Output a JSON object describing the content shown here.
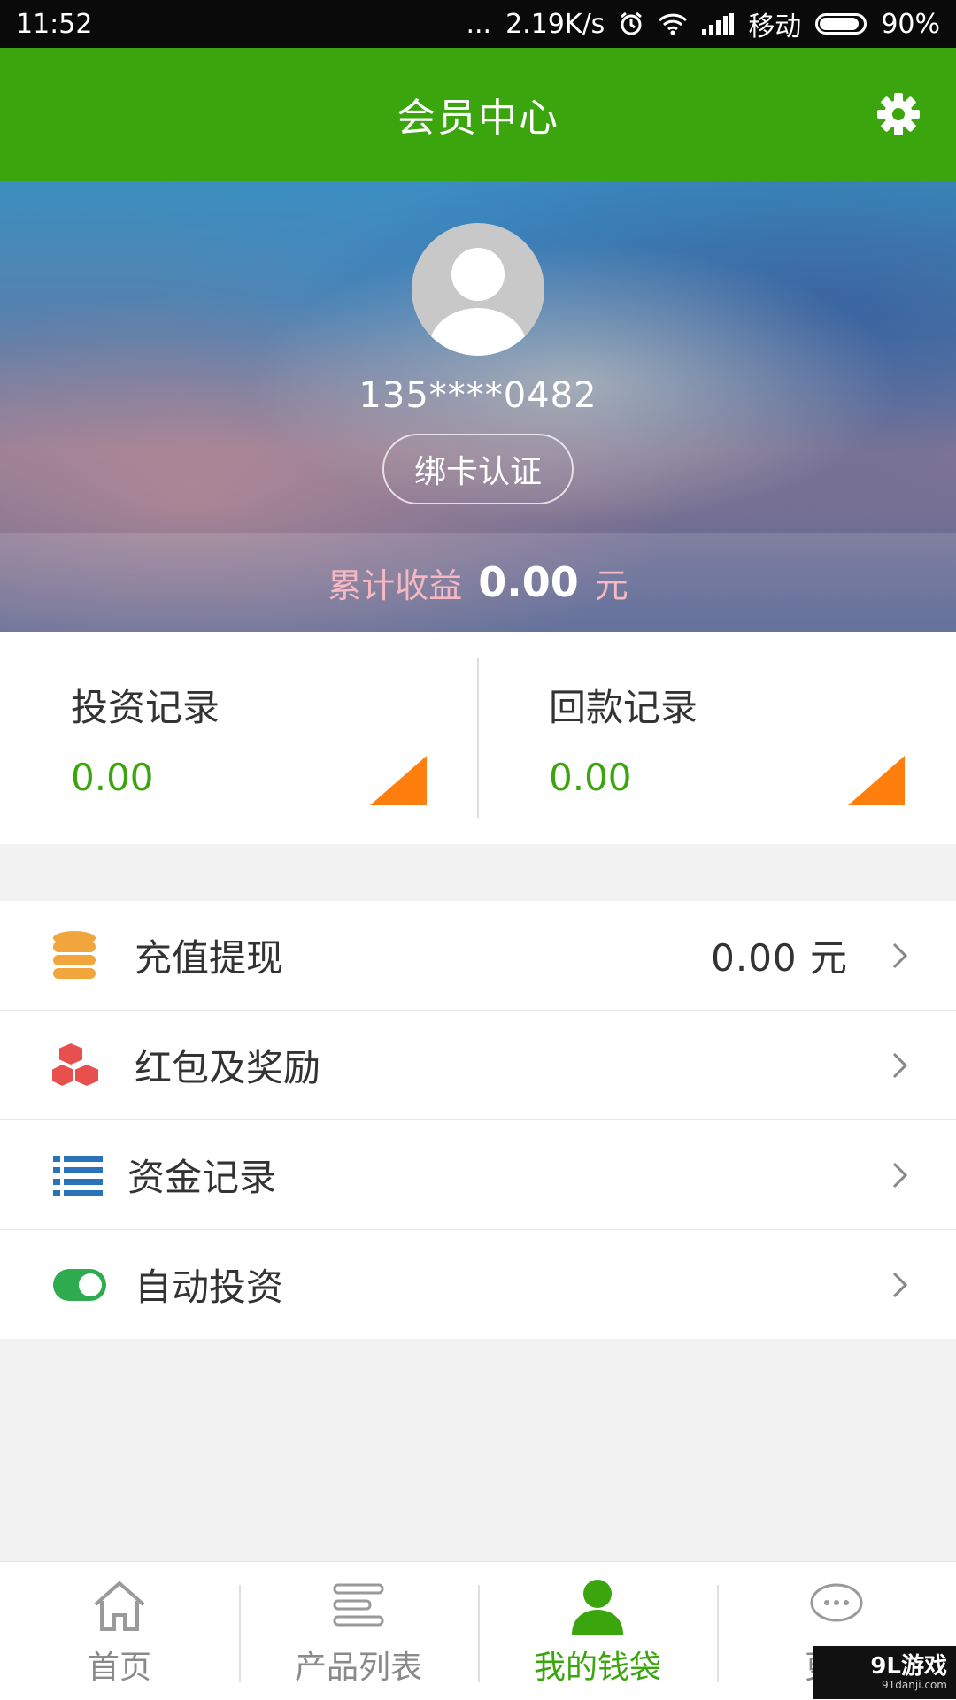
{
  "status_bar": {
    "time": "11:52",
    "dots": "...",
    "speed": "2.19K/s",
    "carrier": "移动",
    "battery": "90%",
    "battery_level": 0.9,
    "icons": [
      "alarm-icon",
      "wifi-icon",
      "signal-icon",
      "battery-icon"
    ]
  },
  "header": {
    "title": "会员中心",
    "settings_icon": "gear-icon"
  },
  "profile": {
    "phone": "135****0482",
    "bind_button": "绑卡认证",
    "earnings_label": "累计收益",
    "earnings_value": "0.00",
    "earnings_unit": "元"
  },
  "records": [
    {
      "title": "投资记录",
      "value": "0.00"
    },
    {
      "title": "回款记录",
      "value": "0.00"
    }
  ],
  "menu": [
    {
      "label": "充值提现",
      "value": "0.00  元",
      "icon": "coins-icon"
    },
    {
      "label": "红包及奖励",
      "icon": "boxes-icon"
    },
    {
      "label": "资金记录",
      "icon": "list-icon"
    },
    {
      "label": "自动投资",
      "icon": "toggle-icon"
    }
  ],
  "bottom_nav": [
    {
      "label": "首页",
      "icon": "home-icon"
    },
    {
      "label": "产品列表",
      "icon": "product-list-icon"
    },
    {
      "label": "我的钱袋",
      "icon": "user-icon",
      "active": true
    },
    {
      "label": "更多",
      "icon": "more-icon"
    }
  ],
  "watermark": {
    "main": "9L游戏",
    "sub": "91danji.com"
  },
  "colors": {
    "brand_green": "#3aa50d",
    "accent_orange": "#ff7f0e",
    "earnings_pink": "#f6b8c2"
  }
}
